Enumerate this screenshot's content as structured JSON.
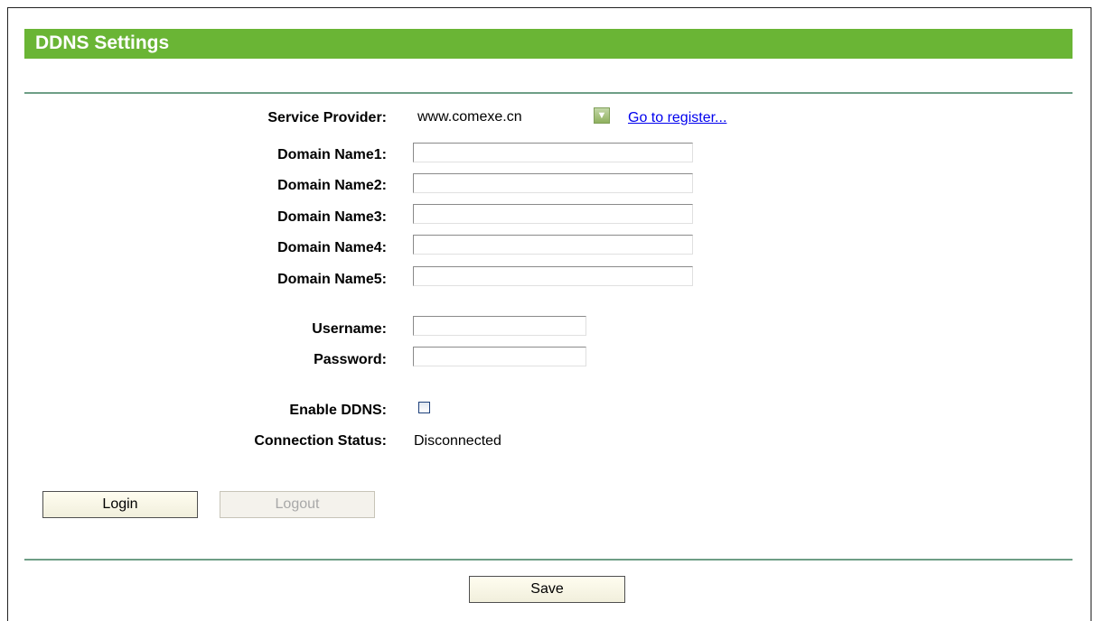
{
  "page_title": "DDNS Settings",
  "form": {
    "service_provider_label": "Service Provider:",
    "service_provider_value": "www.comexe.cn",
    "register_link": "Go to register...",
    "domain_labels": [
      "Domain Name1:",
      "Domain Name2:",
      "Domain Name3:",
      "Domain Name4:",
      "Domain Name5:"
    ],
    "domain_values": [
      "",
      "",
      "",
      "",
      ""
    ],
    "username_label": "Username:",
    "username_value": "",
    "password_label": "Password:",
    "password_value": "",
    "enable_label": "Enable DDNS:",
    "enable_checked": false,
    "status_label": "Connection Status:",
    "status_value": "Disconnected"
  },
  "buttons": {
    "login": "Login",
    "logout": "Logout",
    "save": "Save"
  },
  "colors": {
    "title_bar": "#6ab535",
    "divider": "#6e9e86",
    "link": "#0000ee"
  }
}
